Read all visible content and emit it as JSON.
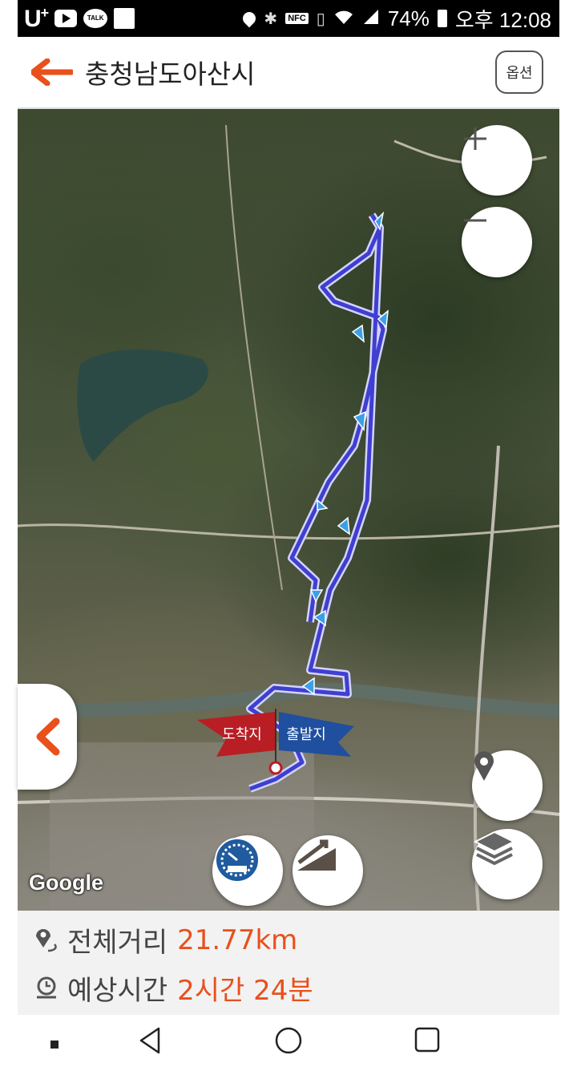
{
  "status_bar": {
    "carrier": "U",
    "carrier_sup": "+",
    "talk_label": "TALK",
    "nfc_label": "NFC",
    "battery": "74%",
    "time": "오후 12:08"
  },
  "header": {
    "title": "충청남도아산시",
    "option_label": "옵션"
  },
  "map": {
    "attribution": "Google",
    "arrival_flag": "도착지",
    "departure_flag": "출발지",
    "colors": {
      "route": "#3f3fd0",
      "route_outline": "#c8c8ff",
      "arrival_flag": "#b81e24",
      "departure_flag": "#1f4f9e",
      "direction_arrow": "#3aa0e8"
    }
  },
  "info": {
    "distance_label": "전체거리",
    "distance_value": "21.77km",
    "time_label": "예상시간",
    "time_value": "2시간 24분"
  },
  "colors": {
    "accent": "#e8501c",
    "back_arrow": "#e8501c"
  }
}
